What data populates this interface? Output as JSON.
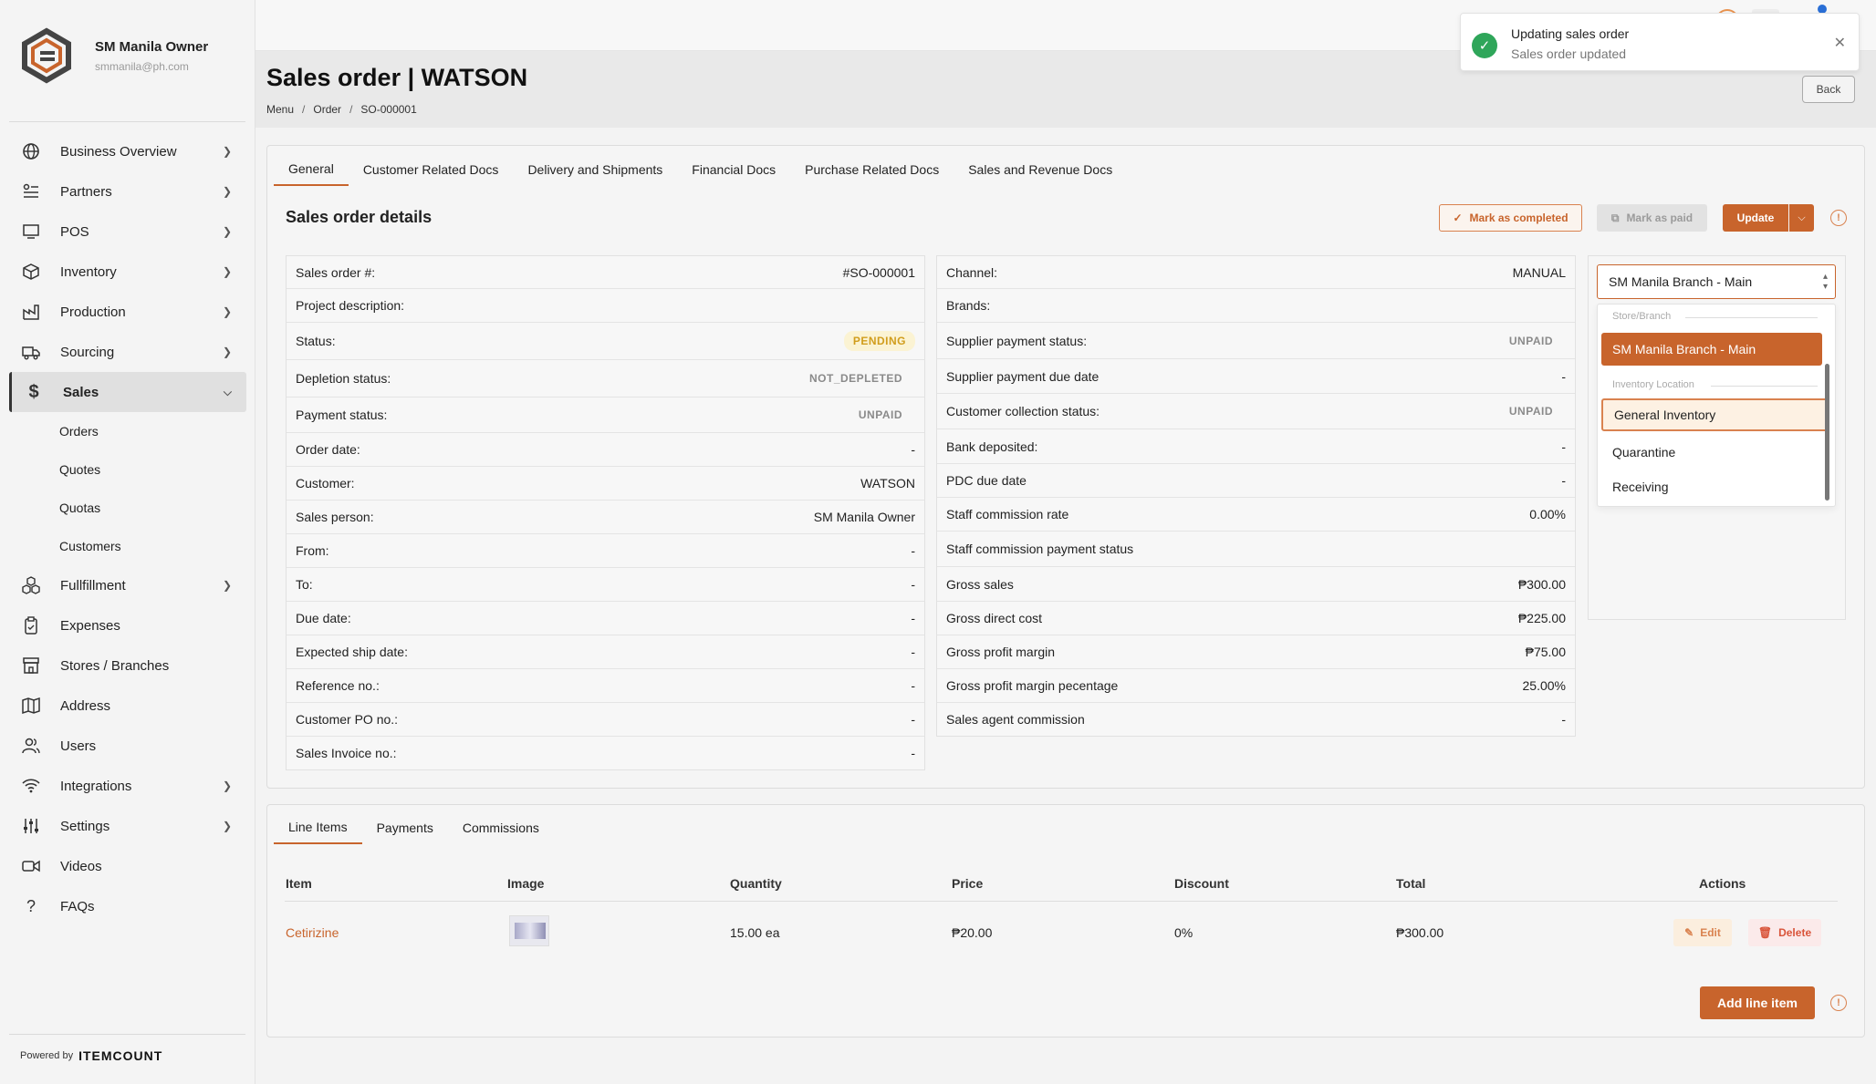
{
  "sidebar": {
    "user_name": "SM Manila Owner",
    "user_email": "smmanila@ph.com",
    "items": [
      {
        "label": "Business Overview",
        "icon": "globe-icon"
      },
      {
        "label": "Partners",
        "icon": "partners-icon"
      },
      {
        "label": "POS",
        "icon": "pos-icon"
      },
      {
        "label": "Inventory",
        "icon": "box-icon"
      },
      {
        "label": "Production",
        "icon": "factory-icon"
      },
      {
        "label": "Sourcing",
        "icon": "truck-icon"
      },
      {
        "label": "Sales",
        "icon": "dollar-icon"
      },
      {
        "label": "Fullfillment",
        "icon": "boxes-icon"
      },
      {
        "label": "Expenses",
        "icon": "clipboard-icon"
      },
      {
        "label": "Stores / Branches",
        "icon": "store-icon"
      },
      {
        "label": "Address",
        "icon": "map-icon"
      },
      {
        "label": "Users",
        "icon": "users-icon"
      },
      {
        "label": "Integrations",
        "icon": "wifi-icon"
      },
      {
        "label": "Settings",
        "icon": "sliders-icon"
      },
      {
        "label": "Videos",
        "icon": "video-icon"
      },
      {
        "label": "FAQs",
        "icon": "question-icon"
      }
    ],
    "sales_sub": [
      "Orders",
      "Quotes",
      "Quotas",
      "Customers"
    ],
    "powered_by": "Powered by",
    "powered_brand": "ITEMCOUNT"
  },
  "toast": {
    "title": "Updating sales order",
    "message": "Sales order updated"
  },
  "header": {
    "title": "Sales order | WATSON",
    "breadcrumb": [
      "Menu",
      "Order",
      "SO-000001"
    ],
    "back_label": "Back"
  },
  "tabs": [
    "General",
    "Customer Related Docs",
    "Delivery and Shipments",
    "Financial Docs",
    "Purchase Related Docs",
    "Sales and Revenue Docs"
  ],
  "details": {
    "section_title": "Sales order details",
    "mark_completed": "Mark as completed",
    "mark_paid": "Mark as paid",
    "update": "Update",
    "left": [
      {
        "label": "Sales order #:",
        "value": "#SO-000001"
      },
      {
        "label": "Project description:",
        "value": ""
      },
      {
        "label": "Status:",
        "value": "PENDING"
      },
      {
        "label": "Depletion status:",
        "value": "NOT_DEPLETED"
      },
      {
        "label": "Payment status:",
        "value": "UNPAID"
      },
      {
        "label": "Order date:",
        "value": "-"
      },
      {
        "label": "Customer:",
        "value": "WATSON"
      },
      {
        "label": "Sales person:",
        "value": "SM Manila Owner"
      },
      {
        "label": "From:",
        "value": "-"
      },
      {
        "label": "To:",
        "value": "-"
      },
      {
        "label": "Due date:",
        "value": "-"
      },
      {
        "label": "Expected ship date:",
        "value": "-"
      },
      {
        "label": "Reference no.:",
        "value": "-"
      },
      {
        "label": "Customer PO no.:",
        "value": "-"
      },
      {
        "label": "Sales Invoice no.:",
        "value": "-"
      }
    ],
    "right": [
      {
        "label": "Channel:",
        "value": "MANUAL"
      },
      {
        "label": "Brands:",
        "value": ""
      },
      {
        "label": "Supplier payment status:",
        "value": "UNPAID"
      },
      {
        "label": "Supplier payment due date",
        "value": "-"
      },
      {
        "label": "Customer collection status:",
        "value": "UNPAID"
      },
      {
        "label": "Bank deposited:",
        "value": "-"
      },
      {
        "label": "PDC due date",
        "value": "-"
      },
      {
        "label": "Staff commission rate",
        "value": "0.00%"
      },
      {
        "label": "Staff commission payment status",
        "value": ""
      },
      {
        "label": "Gross sales",
        "value": "₱300.00"
      },
      {
        "label": "Gross direct cost",
        "value": "₱225.00"
      },
      {
        "label": "Gross profit margin",
        "value": "₱75.00"
      },
      {
        "label": "Gross profit margin pecentage",
        "value": "25.00%"
      },
      {
        "label": "Sales agent commission",
        "value": "-"
      }
    ]
  },
  "branch_dropdown": {
    "value": "SM Manila Branch - Main",
    "group1_label": "Store/Branch",
    "group1_options": [
      "SM Manila Branch - Main"
    ],
    "group2_label": "Inventory Location",
    "group2_options": [
      "General Inventory",
      "Quarantine",
      "Receiving"
    ]
  },
  "line_tabs": [
    "Line Items",
    "Payments",
    "Commissions"
  ],
  "line_table": {
    "headers": [
      "Item",
      "Image",
      "Quantity",
      "Price",
      "Discount",
      "Total",
      "Actions"
    ],
    "rows": [
      {
        "item": "Cetirizine",
        "quantity": "15.00 ea",
        "price": "₱20.00",
        "discount": "0%",
        "total": "₱300.00",
        "edit": "Edit",
        "delete": "Delete"
      }
    ],
    "add_label": "Add line item"
  },
  "colors": {
    "accent": "#c8642c",
    "success": "#2fa65a",
    "pending": "#d19d1c"
  }
}
